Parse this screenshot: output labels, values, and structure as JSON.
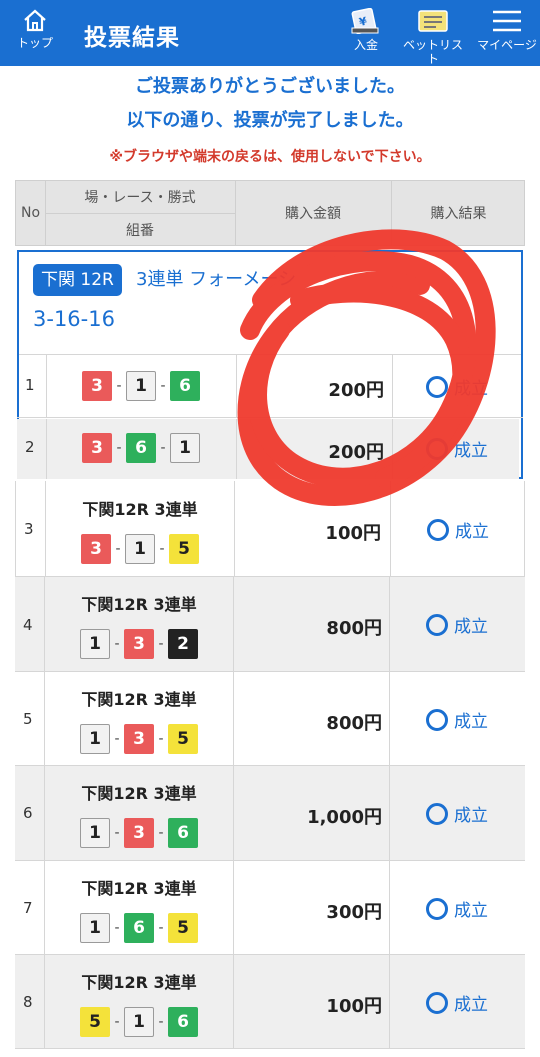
{
  "header": {
    "top_label": "トップ",
    "title": "投票結果",
    "deposit_label": "入金",
    "betlist_label": "ベットリスト",
    "mypage_label": "マイページ"
  },
  "messages": {
    "thanks": "ご投票ありがとうございました。",
    "complete": "以下の通り、投票が完了しました。",
    "warning": "※ブラウザや端末の戻るは、使用しないで下さい。"
  },
  "table_header": {
    "no": "No",
    "race": "場・レース・勝式",
    "combo": "組番",
    "amount": "購入金額",
    "result": "購入結果"
  },
  "group": {
    "race": "下関 12R",
    "type": "3連単 フォーメーシ",
    "combo": "3-16-16"
  },
  "rows": [
    {
      "no": "1",
      "label": "",
      "n1": "3",
      "n2": "1",
      "n3": "6",
      "amount": "200円",
      "result": "成立"
    },
    {
      "no": "2",
      "label": "",
      "n1": "3",
      "n2": "6",
      "n3": "1",
      "amount": "200円",
      "result": "成立"
    },
    {
      "no": "3",
      "label": "下関12R 3連単",
      "n1": "3",
      "n2": "1",
      "n3": "5",
      "amount": "100円",
      "result": "成立"
    },
    {
      "no": "4",
      "label": "下関12R 3連単",
      "n1": "1",
      "n2": "3",
      "n3": "2",
      "amount": "800円",
      "result": "成立"
    },
    {
      "no": "5",
      "label": "下関12R 3連単",
      "n1": "1",
      "n2": "3",
      "n3": "5",
      "amount": "800円",
      "result": "成立"
    },
    {
      "no": "6",
      "label": "下関12R 3連単",
      "n1": "1",
      "n2": "3",
      "n3": "6",
      "amount": "1,000円",
      "result": "成立"
    },
    {
      "no": "7",
      "label": "下関12R 3連単",
      "n1": "1",
      "n2": "6",
      "n3": "5",
      "amount": "300円",
      "result": "成立"
    },
    {
      "no": "8",
      "label": "下関12R 3連単",
      "n1": "5",
      "n2": "1",
      "n3": "6",
      "amount": "100円",
      "result": "成立"
    }
  ],
  "colors": {
    "accent": "#1a6fd1",
    "warning": "#d33a2c",
    "annotation": "#f03a2e"
  }
}
